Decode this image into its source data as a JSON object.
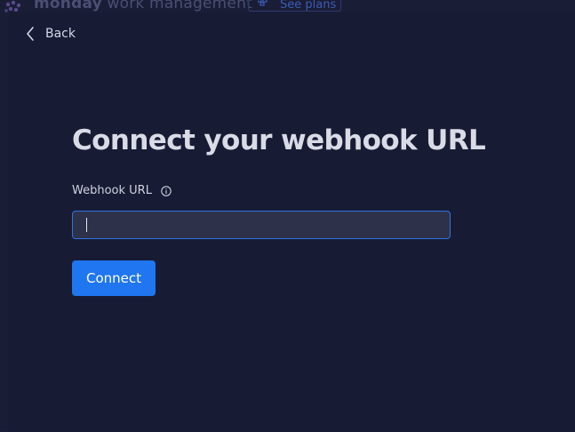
{
  "app": {
    "brand_bold": "monday",
    "brand_light": " work management",
    "see_plans_label": "See plans"
  },
  "nav": {
    "back_label": "Back"
  },
  "form": {
    "title": "Connect your webhook URL",
    "webhook_label": "Webhook URL",
    "webhook_value": "",
    "webhook_placeholder": "",
    "connect_label": "Connect"
  },
  "colors": {
    "accent": "#1f76f0",
    "panel_bg": "#181b34",
    "input_bg": "#2d3149",
    "input_border": "#2f74e0"
  },
  "icons": {
    "back": "chevron-left-icon",
    "info": "info-icon",
    "logo": "monday-logo-icon",
    "plans": "plans-icon"
  }
}
